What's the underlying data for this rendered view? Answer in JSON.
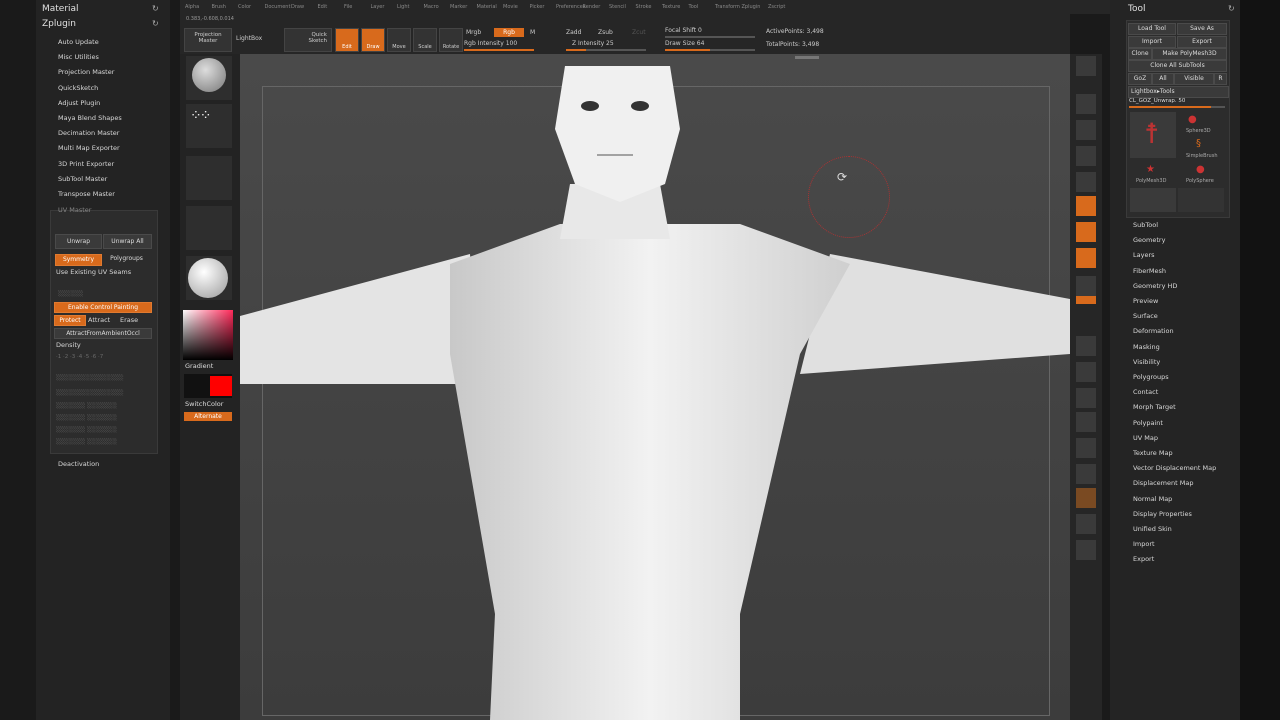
{
  "left": {
    "material_title": "Material",
    "zplugin_title": "Zplugin",
    "items": [
      "Auto Update",
      "Misc Utilities",
      "Projection Master",
      "QuickSketch",
      "Adjust Plugin",
      "Maya Blend Shapes",
      "Decimation Master",
      "Multi Map Exporter",
      "3D Print Exporter",
      "SubTool Master",
      "Transpose Master"
    ],
    "uv_master": "UV Master",
    "unwrap": "Unwrap",
    "unwrap_all": "Unwrap All",
    "symmetry": "Symmetry",
    "polygroups": "Polygroups",
    "use_existing": "Use Existing UV Seams",
    "enable_control": "Enable Control Painting",
    "protect": "Protect",
    "attract": "Attract",
    "erase": "Erase",
    "attract_ambient": "AttractFromAmbientOccl",
    "density": "Density",
    "deactivation": "Deactivation"
  },
  "menu": [
    "Alpha",
    "Brush",
    "Color",
    "Document",
    "Draw",
    "Edit",
    "File",
    "Layer",
    "Light",
    "Macro",
    "Marker",
    "Material",
    "Movie",
    "Picker",
    "Preferences",
    "Render",
    "Stencil",
    "Stroke",
    "Texture",
    "Tool",
    "Transform",
    "Zplugin",
    "Zscript"
  ],
  "toolbar": {
    "coords": "0.383,-0.608,0.014",
    "projection_master": "Projection\nMaster",
    "lightbox": "LightBox",
    "quick_sketch": "Quick\nSketch",
    "edit": "Edit",
    "draw": "Draw",
    "move": "Move",
    "scale": "Scale",
    "rotate": "Rotate",
    "mrgb": "Mrgb",
    "rgb": "Rgb",
    "m": "M",
    "rgb_intensity": "Rgb Intensity 100",
    "zadd": "Zadd",
    "zsub": "Zsub",
    "zcut": "Zcut",
    "z_intensity": "Z Intensity 25",
    "focal_shift": "Focal Shift 0",
    "draw_size": "Draw Size 64",
    "active_points": "ActivePoints: 3,498",
    "total_points": "TotalPoints: 3,498",
    "accent": "#d86a1c"
  },
  "shelf": {
    "gradient": "Gradient",
    "switch_color": "SwitchColor",
    "alternate": "Alternate",
    "secondary_color": "#ff0000"
  },
  "right": {
    "tool_title": "Tool",
    "load_tool": "Load Tool",
    "save_as": "Save As",
    "import": "Import",
    "export": "Export",
    "clone": "Clone",
    "make_polymesh": "Make PolyMesh3D",
    "clone_all": "Clone All SubTools",
    "goz": "GoZ",
    "all": "All",
    "visible": "Visible",
    "r": "R",
    "lightbox_tools": "Lightbox▸Tools",
    "current_tool": "CL_GOZ_Unwrap. 50",
    "tools": [
      "Sphere3D",
      "SimpleBrush",
      "PolyMesh3D",
      "PolySphere"
    ],
    "sections": [
      "SubTool",
      "Geometry",
      "Layers",
      "FiberMesh",
      "Geometry HD",
      "Preview",
      "Surface",
      "Deformation",
      "Masking",
      "Visibility",
      "Polygroups",
      "Contact",
      "Morph Target",
      "Polypaint",
      "UV Map",
      "Texture Map",
      "Vector Displacement Map",
      "Displacement Map",
      "Normal Map",
      "Display Properties",
      "Unified Skin",
      "Import",
      "Export"
    ]
  }
}
